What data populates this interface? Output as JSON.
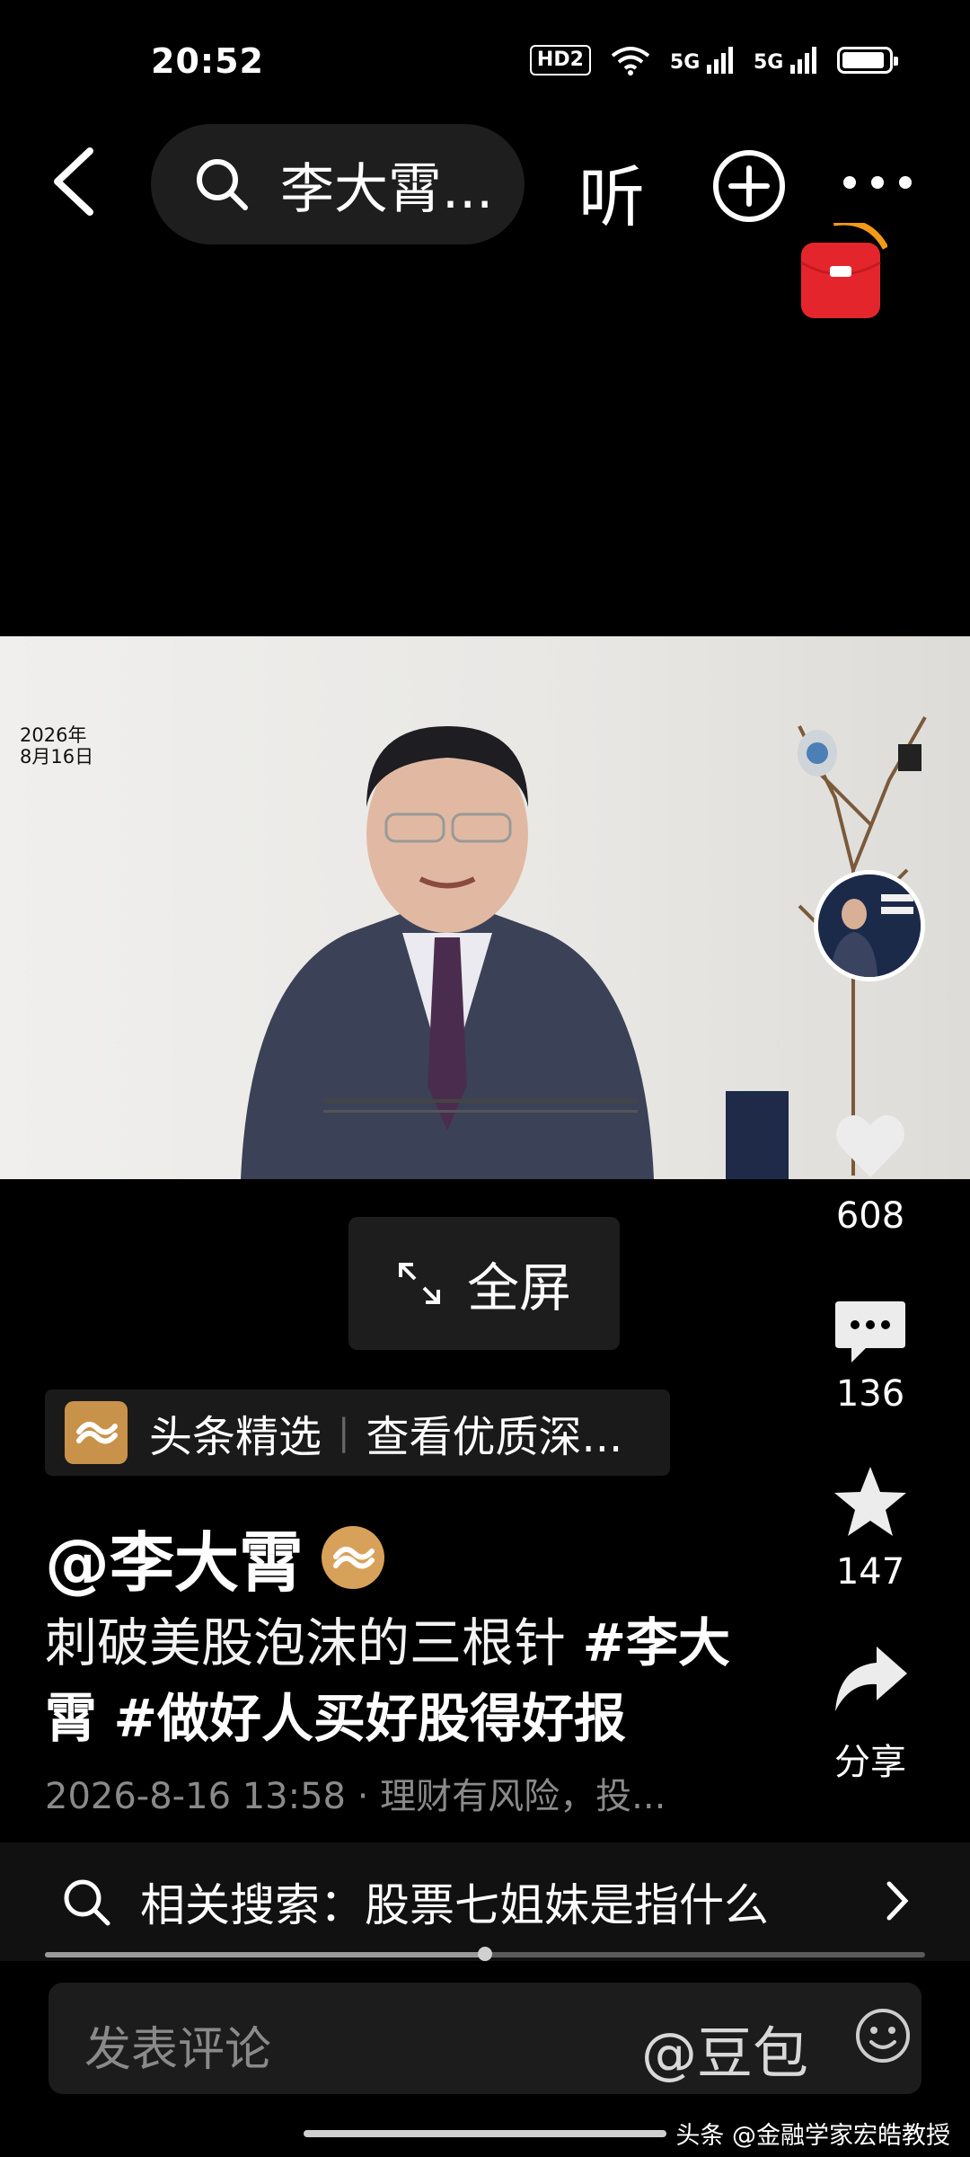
{
  "status_bar": {
    "time": "20:52",
    "hd_label": "HD2",
    "signal1": "5G",
    "signal2": "5G"
  },
  "nav": {
    "search_text": "李大霄...",
    "listen_label": "听"
  },
  "video": {
    "overlay_date_line1": "2026年",
    "overlay_date_line2": "8月16日"
  },
  "actions": {
    "likes": "608",
    "comments": "136",
    "favorites": "147",
    "share_label": "分享"
  },
  "fullscreen_label": "全屏",
  "channel": {
    "name": "头条精选",
    "separator": "|",
    "link": "查看优质深..."
  },
  "author": {
    "handle": "@李大霄"
  },
  "caption": {
    "text": "刺破美股泡沫的三根针 ",
    "tag1": "#李大霄",
    "tag2": "#做好人买好股得好报"
  },
  "meta_line": "2026-8-16 13:58 · 理财有风险，投...",
  "related_search": {
    "label": "相关搜索：",
    "query": "股票七姐妹是指什么"
  },
  "playback": {
    "progress": 0.5
  },
  "comment_bar": {
    "placeholder": "发表评论",
    "at_label": "@豆包"
  },
  "watermark": "头条 @金融学家宏皓教授"
}
